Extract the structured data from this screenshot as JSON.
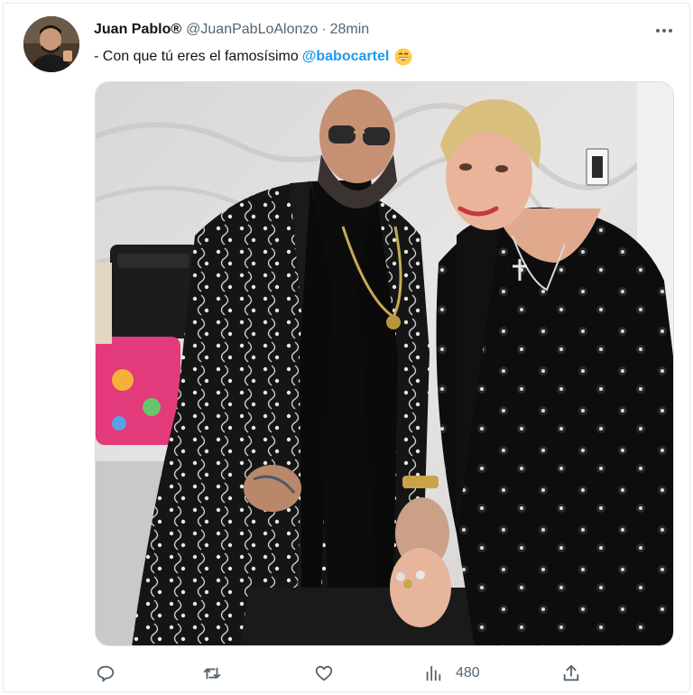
{
  "tweet": {
    "author": {
      "display_name": "Juan Pablo",
      "verified_mark": "®",
      "handle": "@JuanPabLoAlonzo",
      "time": "28min"
    },
    "text_prefix": "- Con que tú eres el famosísimo",
    "mention": "@babocartel",
    "emoji": "grinning-face-emoji"
  },
  "metrics": {
    "views": "480"
  },
  "icons": {
    "more": "more-options-icon",
    "reply": "reply-icon",
    "retweet": "retweet-icon",
    "like": "heart-icon",
    "views": "views-bars-icon",
    "share": "share-icon"
  },
  "colors": {
    "accent": "#1d9bf0",
    "text": "#0f1419",
    "muted": "#536471"
  }
}
